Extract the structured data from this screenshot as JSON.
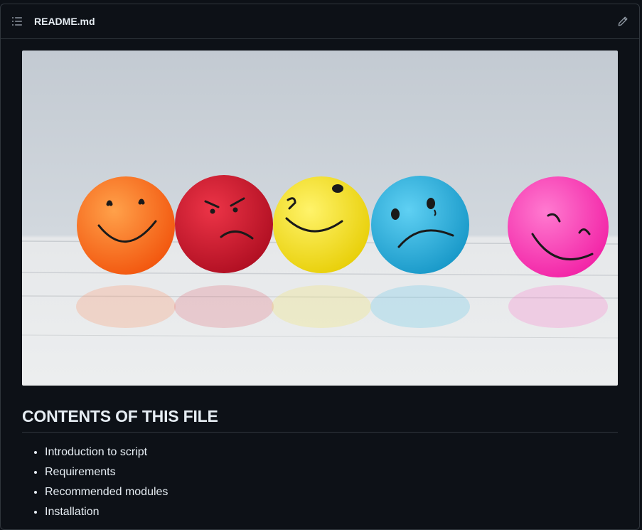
{
  "file": {
    "name": "README.md"
  },
  "icons": {
    "list": "list-unordered-icon",
    "edit": "pencil-icon"
  },
  "image": {
    "alt": "Five colorful emoji stress balls with different facial expressions"
  },
  "contents": {
    "heading": "CONTENTS OF THIS FILE",
    "items": [
      "Introduction to script",
      "Requirements",
      "Recommended modules",
      "Installation"
    ]
  },
  "colors": {
    "background": "#0d1117",
    "border": "#30363d",
    "text": "#e6edf3",
    "ball_orange": "#ff6a1a",
    "ball_red": "#d1132a",
    "ball_yellow": "#f4e21c",
    "ball_blue": "#26b3e0",
    "ball_pink": "#ff3fb8"
  }
}
